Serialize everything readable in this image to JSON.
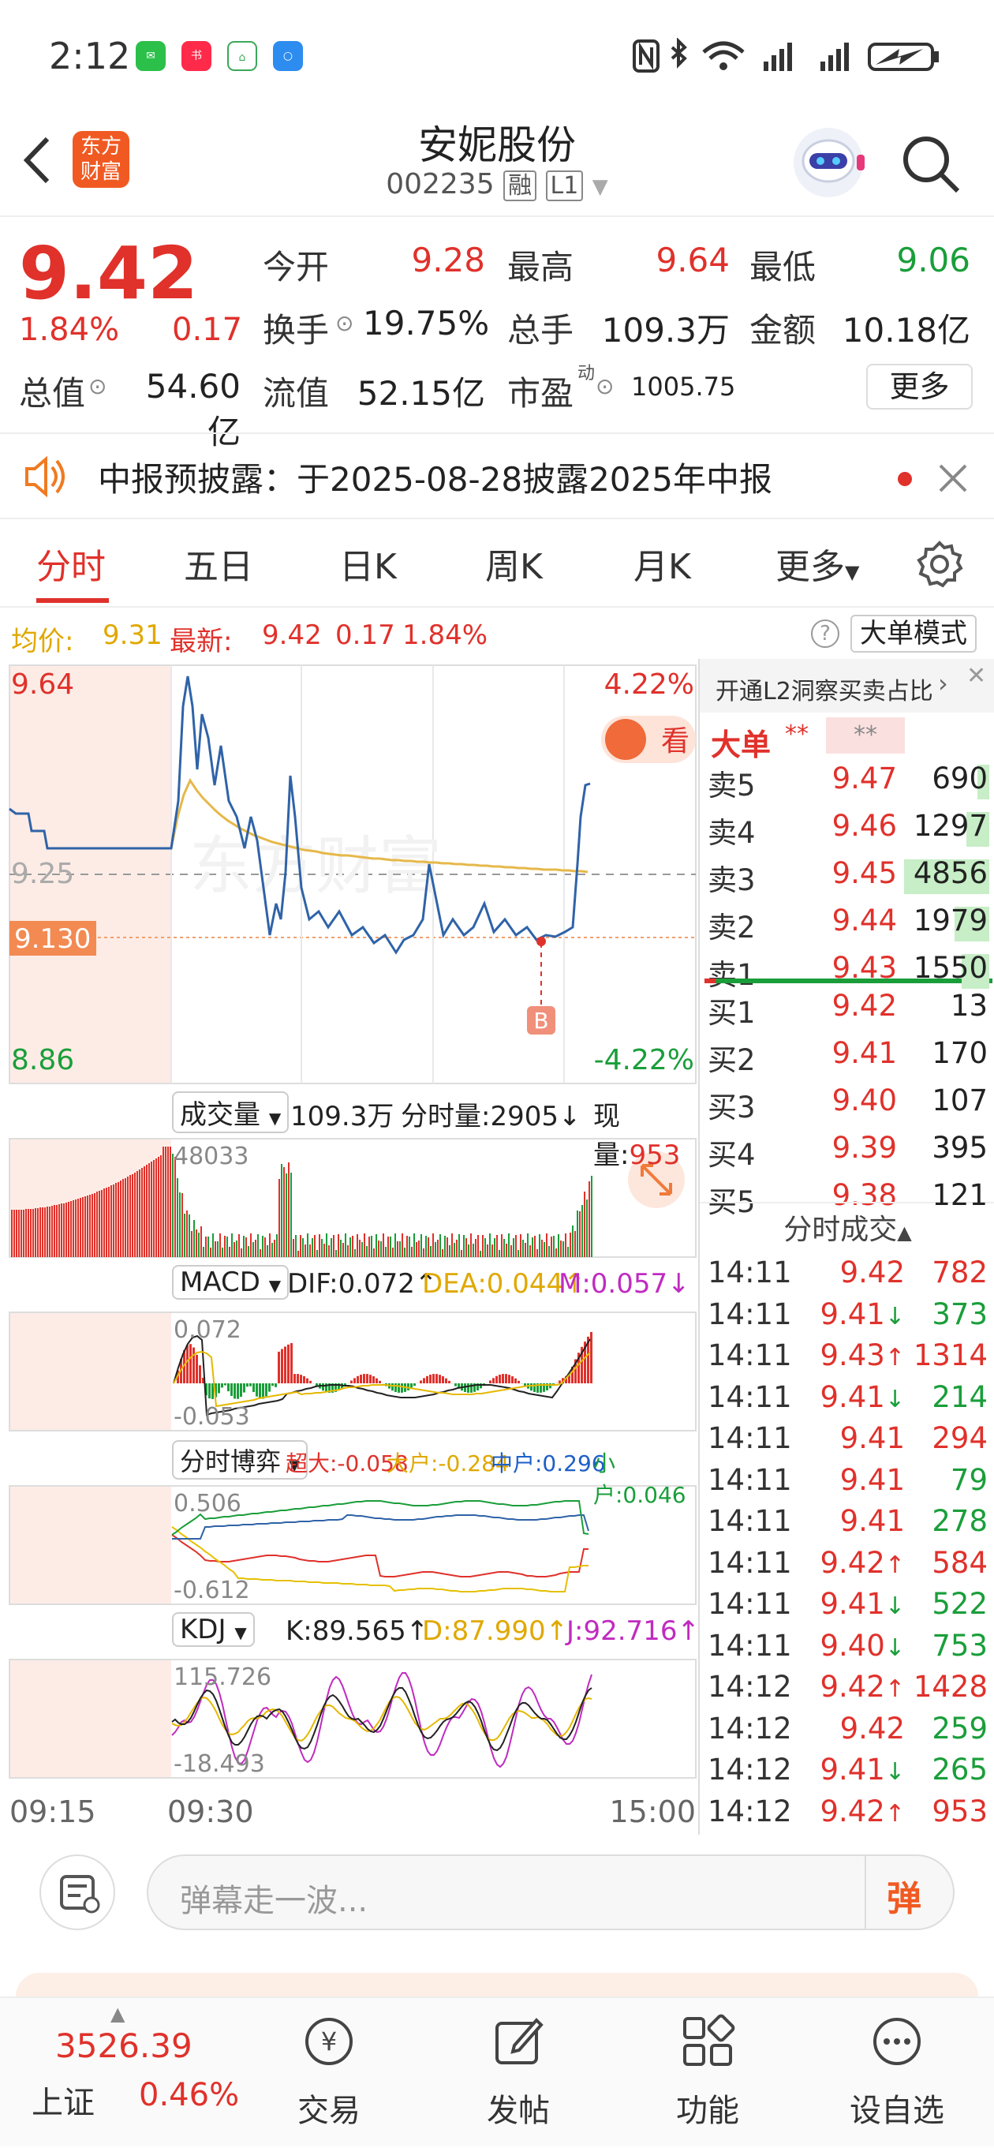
{
  "status": {
    "time": "2:12"
  },
  "header": {
    "logo_line1": "东方",
    "logo_line2": "财富",
    "name": "安妮股份",
    "code": "002235",
    "badge_rong": "融",
    "badge_l1": "L1"
  },
  "quote": {
    "price": "9.42",
    "pct": "1.84%",
    "chg": "0.17",
    "open_label": "今开",
    "open": "9.28",
    "high_label": "最高",
    "high": "9.64",
    "low_label": "最低",
    "low": "9.06",
    "turnover_label": "换手",
    "turnover": "19.75%",
    "volume_label": "总手",
    "volume": "109.3万",
    "amount_label": "金额",
    "amount": "10.18亿",
    "mcap_label": "总值",
    "mcap": "54.60亿",
    "float_label": "流值",
    "float": "52.15亿",
    "pe_label": "市盈",
    "pe_super": "动",
    "pe": "1005.75",
    "more": "更多"
  },
  "notice": {
    "text": "中报预披露：于2025-08-28披露2025年中报"
  },
  "tabs": [
    "分时",
    "五日",
    "日K",
    "周K",
    "月K",
    "更多"
  ],
  "avgbar": {
    "avg_label": "均价:",
    "avg": "9.31",
    "latest_label": "最新:",
    "latest": "9.42",
    "chg": "0.17",
    "pct": "1.84%",
    "bigorder": "大单模式"
  },
  "chart": {
    "y_top": "9.64",
    "y_mid": "9.25",
    "y_bot": "8.86",
    "pct_top": "4.22%",
    "pct_bot": "-4.22%",
    "marker": "9.130",
    "buy_marker": "B",
    "watermark": "东方财富",
    "promo": "看",
    "vol_sel": "成交量",
    "vol_total": "109.3万",
    "vol_fs_label": "分时量:",
    "vol_fs": "2905",
    "vol_now_label": "现量:",
    "vol_now": "953",
    "vol_max": "48033",
    "macd_sel": "MACD",
    "dif": "DIF:0.072",
    "dea": "DEA:0.044",
    "m": "M:0.057",
    "macd_top": "0.072",
    "macd_bot": "-0.053",
    "bo_sel": "分时博弈",
    "bo_sup": "超大:-0.058",
    "bo_big": "大户:-0.284",
    "bo_mid": "中户:0.296",
    "bo_small": "小户:0.046",
    "bo_top": "0.506",
    "bo_bot": "-0.612",
    "kdj_sel": "KDJ",
    "k": "K:89.565",
    "d": "D:87.990",
    "j": "J:92.716",
    "kdj_top": "115.726",
    "kdj_bot": "-18.493",
    "t_start": "09:15",
    "t_open": "09:30",
    "t_end": "15:00"
  },
  "side": {
    "promo": "开通L2洞察买卖占比",
    "big": "大单",
    "stars1": "**",
    "stars2": "**",
    "asks": [
      {
        "n": "卖5",
        "p": "9.47",
        "v": "690",
        "bar": 0.14
      },
      {
        "n": "卖4",
        "p": "9.46",
        "v": "1297",
        "bar": 0.27
      },
      {
        "n": "卖3",
        "p": "9.45",
        "v": "4856",
        "bar": 1.0
      },
      {
        "n": "卖2",
        "p": "9.44",
        "v": "1979",
        "bar": 0.41
      },
      {
        "n": "卖1",
        "p": "9.43",
        "v": "1550",
        "bar": 0.32
      }
    ],
    "bids": [
      {
        "n": "买1",
        "p": "9.42",
        "v": "13"
      },
      {
        "n": "买2",
        "p": "9.41",
        "v": "170"
      },
      {
        "n": "买3",
        "p": "9.40",
        "v": "107"
      },
      {
        "n": "买4",
        "p": "9.39",
        "v": "395"
      },
      {
        "n": "买5",
        "p": "9.38",
        "v": "121"
      }
    ],
    "trades_title": "分时成交",
    "trades": [
      {
        "t": "14:11",
        "p": "9.42",
        "a": "",
        "v": "782",
        "c": "red"
      },
      {
        "t": "14:11",
        "p": "9.41",
        "a": "↓",
        "v": "373",
        "c": "green"
      },
      {
        "t": "14:11",
        "p": "9.43",
        "a": "↑",
        "v": "1314",
        "c": "red"
      },
      {
        "t": "14:11",
        "p": "9.41",
        "a": "↓",
        "v": "214",
        "c": "green"
      },
      {
        "t": "14:11",
        "p": "9.41",
        "a": "",
        "v": "294",
        "c": "red"
      },
      {
        "t": "14:11",
        "p": "9.41",
        "a": "",
        "v": "79",
        "c": "green"
      },
      {
        "t": "14:11",
        "p": "9.41",
        "a": "",
        "v": "278",
        "c": "green"
      },
      {
        "t": "14:11",
        "p": "9.42",
        "a": "↑",
        "v": "584",
        "c": "red"
      },
      {
        "t": "14:11",
        "p": "9.41",
        "a": "↓",
        "v": "522",
        "c": "green"
      },
      {
        "t": "14:11",
        "p": "9.40",
        "a": "↓",
        "v": "753",
        "c": "green"
      },
      {
        "t": "14:12",
        "p": "9.42",
        "a": "↑",
        "v": "1428",
        "c": "red"
      },
      {
        "t": "14:12",
        "p": "9.42",
        "a": "",
        "v": "259",
        "c": "green"
      },
      {
        "t": "14:12",
        "p": "9.41",
        "a": "↓",
        "v": "265",
        "c": "green"
      },
      {
        "t": "14:12",
        "p": "9.42",
        "a": "↑",
        "v": "953",
        "c": "red"
      }
    ]
  },
  "danmu": {
    "placeholder": "弹幕走一波...",
    "btn": "弹"
  },
  "bottom": {
    "index_val": "3526.39",
    "index_name": "上证",
    "index_pct": "0.46%",
    "items": [
      "交易",
      "发帖",
      "功能",
      "设自选"
    ]
  },
  "colors": {
    "up": "#e0312b",
    "down": "#1a9e3a",
    "line": "#2f63a8",
    "avg": "#e6b84a"
  }
}
